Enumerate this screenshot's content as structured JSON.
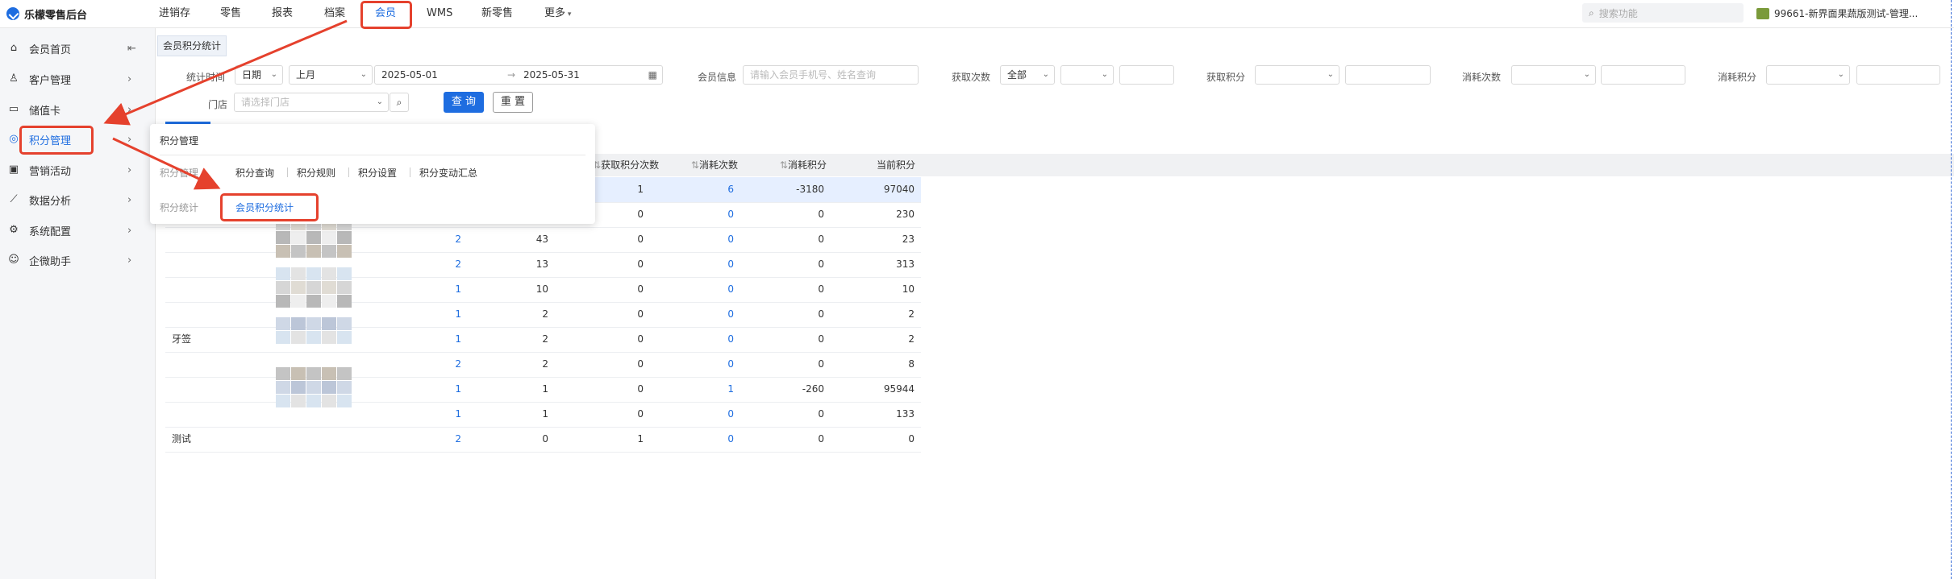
{
  "app": {
    "title": "乐檬零售后台"
  },
  "topnav": {
    "items": [
      "进销存",
      "零售",
      "报表",
      "档案",
      "会员",
      "WMS",
      "新零售",
      "更多"
    ],
    "active": "会员",
    "search_placeholder": "搜索功能",
    "org": "99661-新界面果蔬版测试-管理..."
  },
  "sidebar": {
    "collapse_icon": "collapse-icon",
    "items": [
      {
        "label": "会员首页",
        "icon": "home-icon"
      },
      {
        "label": "客户管理",
        "icon": "user-icon"
      },
      {
        "label": "储值卡",
        "icon": "card-icon"
      },
      {
        "label": "积分管理",
        "icon": "database-icon",
        "active": true
      },
      {
        "label": "营销活动",
        "icon": "campaign-icon"
      },
      {
        "label": "数据分析",
        "icon": "chart-icon"
      },
      {
        "label": "系统配置",
        "icon": "gear-icon"
      },
      {
        "label": "企微助手",
        "icon": "chat-icon"
      }
    ]
  },
  "tabs": {
    "current": "会员积分统计"
  },
  "filters": {
    "stat_time_label": "统计时间",
    "date_type": "日期",
    "period": "上月",
    "date_from": "2025-05-01",
    "date_to": "2025-05-31",
    "member_info_label": "会员信息",
    "member_info_placeholder": "请输入会员手机号、姓名查询",
    "get_times_label": "获取次数",
    "get_times_value": "全部",
    "get_points_label": "获取积分",
    "consume_times_label": "消耗次数",
    "consume_points_label": "消耗积分",
    "store_label": "门店",
    "store_placeholder": "请选择门店",
    "query_button": "查 询",
    "reset_button": "重 置"
  },
  "flyout": {
    "title": "积分管理",
    "group1": "积分管理",
    "group1_items": [
      "积分查询",
      "积分规则",
      "积分设置",
      "积分变动汇总"
    ],
    "group2": "积分统计",
    "group2_items": [
      "会员积分统计"
    ]
  },
  "table": {
    "columns": [
      "获取积分次数",
      "消耗次数",
      "消耗积分",
      "当前积分"
    ],
    "rows": [
      {
        "name": "",
        "c1": "",
        "c2": "",
        "c3": "1",
        "c4": "6",
        "c5": "-3180",
        "c6": "97040"
      },
      {
        "name": "",
        "c1": "",
        "c2": "",
        "c3": "0",
        "c4": "0",
        "c5": "0",
        "c6": "230"
      },
      {
        "name": "",
        "c1": "2",
        "c2": "43",
        "c3": "0",
        "c4": "0",
        "c5": "0",
        "c6": "23"
      },
      {
        "name": "",
        "c1": "2",
        "c2": "13",
        "c3": "0",
        "c4": "0",
        "c5": "0",
        "c6": "313"
      },
      {
        "name": "",
        "c1": "1",
        "c2": "10",
        "c3": "0",
        "c4": "0",
        "c5": "0",
        "c6": "10"
      },
      {
        "name": "",
        "c1": "1",
        "c2": "2",
        "c3": "0",
        "c4": "0",
        "c5": "0",
        "c6": "2"
      },
      {
        "name": "牙签",
        "c1": "1",
        "c2": "2",
        "c3": "0",
        "c4": "0",
        "c5": "0",
        "c6": "2"
      },
      {
        "name": "",
        "c1": "2",
        "c2": "2",
        "c3": "0",
        "c4": "0",
        "c5": "0",
        "c6": "8"
      },
      {
        "name": "",
        "c1": "1",
        "c2": "1",
        "c3": "0",
        "c4": "1",
        "c5": "-260",
        "c6": "95944"
      },
      {
        "name": "",
        "c1": "1",
        "c2": "1",
        "c3": "0",
        "c4": "0",
        "c5": "0",
        "c6": "133"
      },
      {
        "name": "测试",
        "c1": "2",
        "c2": "0",
        "c3": "1",
        "c4": "0",
        "c5": "0",
        "c6": "0"
      }
    ]
  },
  "colors": {
    "accent": "#1e6de0",
    "annotation": "#e5412d"
  }
}
